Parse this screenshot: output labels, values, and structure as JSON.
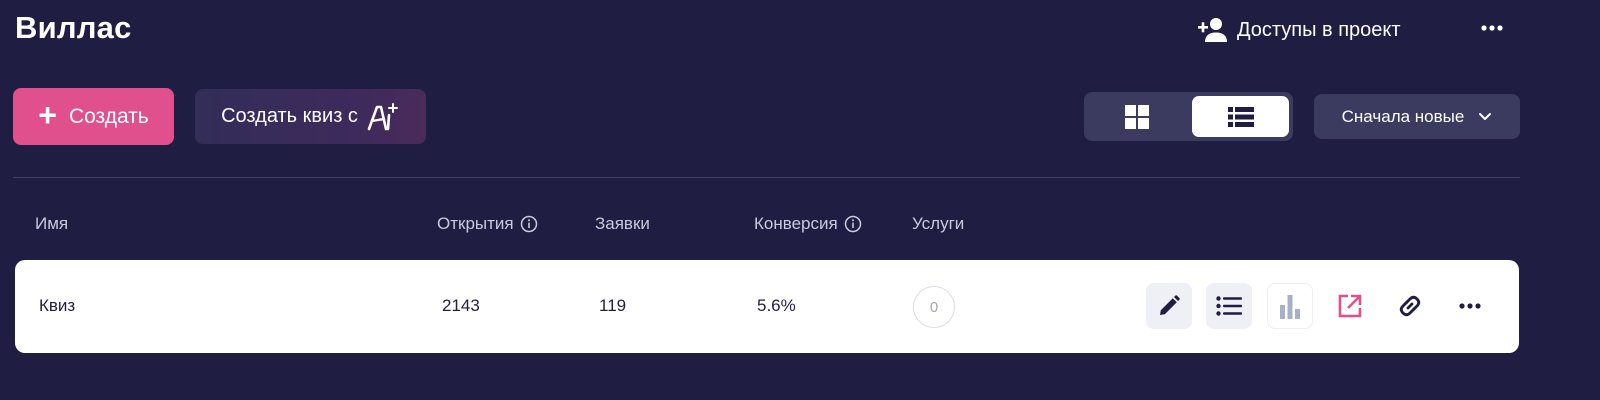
{
  "header": {
    "title": "Виллас",
    "access_label": "Доступы в проект",
    "access_icon": "add-person-icon",
    "more_icon": "more-dots-icon"
  },
  "toolbar": {
    "create_label": "Создать",
    "create_ai_label": "Создать квиз с",
    "view_modes": [
      "grid-view-icon",
      "list-view-icon"
    ],
    "active_view": "list",
    "sort_label": "Сначала новые"
  },
  "table": {
    "columns": {
      "name": "Имя",
      "opens": "Открытия",
      "leads": "Заявки",
      "conversion": "Конверсия",
      "services": "Услуги"
    },
    "rows": [
      {
        "name": "Квиз",
        "opens": "2143",
        "leads": "119",
        "conversion": "5.6%",
        "services": "0"
      }
    ],
    "row_actions": [
      "edit-icon",
      "list-icon",
      "stats-icon",
      "open-external-icon",
      "link-icon",
      "more-dots-icon"
    ]
  },
  "colors": {
    "background": "#1f1e42",
    "accent": "#e0508d",
    "panel": "#3a3b5e",
    "row_bg": "#ffffff"
  }
}
